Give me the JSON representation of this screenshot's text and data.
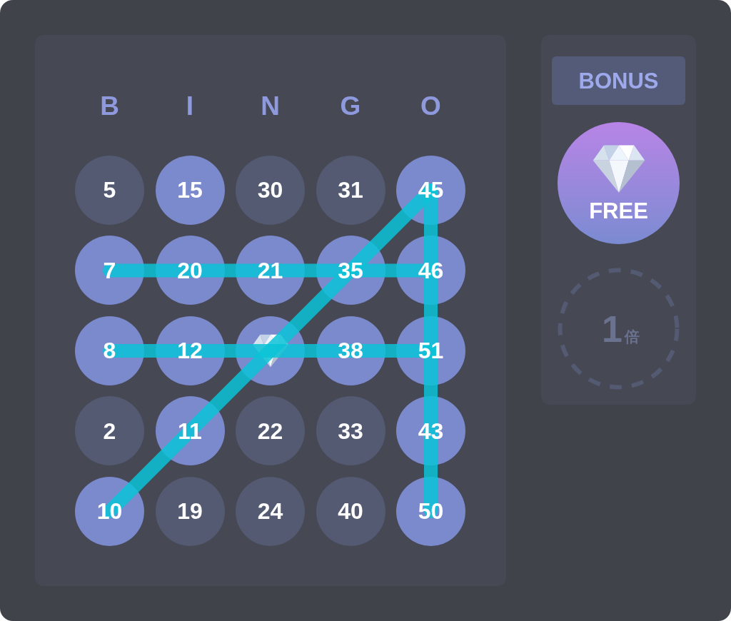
{
  "board": {
    "columns": [
      {
        "letter": "B",
        "line_through": false
      },
      {
        "letter": "I",
        "line_through": false
      },
      {
        "letter": "N",
        "line_through": false
      },
      {
        "letter": "G",
        "line_through": false
      },
      {
        "letter": "O",
        "line_through": true
      }
    ],
    "rows": [
      {
        "line_through": false,
        "cells": [
          {
            "kind": "number",
            "number": "5",
            "marked": false
          },
          {
            "kind": "number",
            "number": "15",
            "marked": true
          },
          {
            "kind": "number",
            "number": "30",
            "marked": false
          },
          {
            "kind": "number",
            "number": "31",
            "marked": false
          },
          {
            "kind": "number",
            "number": "45",
            "marked": true
          }
        ]
      },
      {
        "line_through": true,
        "cells": [
          {
            "kind": "number",
            "number": "7",
            "marked": true
          },
          {
            "kind": "number",
            "number": "20",
            "marked": true
          },
          {
            "kind": "number",
            "number": "21",
            "marked": true
          },
          {
            "kind": "number",
            "number": "35",
            "marked": true
          },
          {
            "kind": "number",
            "number": "46",
            "marked": true
          }
        ]
      },
      {
        "line_through": true,
        "cells": [
          {
            "kind": "number",
            "number": "8",
            "marked": true
          },
          {
            "kind": "number",
            "number": "12",
            "marked": true
          },
          {
            "kind": "free",
            "marked": true
          },
          {
            "kind": "number",
            "number": "38",
            "marked": true
          },
          {
            "kind": "number",
            "number": "51",
            "marked": true
          }
        ]
      },
      {
        "line_through": false,
        "cells": [
          {
            "kind": "number",
            "number": "2",
            "marked": false
          },
          {
            "kind": "number",
            "number": "11",
            "marked": true
          },
          {
            "kind": "number",
            "number": "22",
            "marked": false
          },
          {
            "kind": "number",
            "number": "33",
            "marked": false
          },
          {
            "kind": "number",
            "number": "43",
            "marked": true
          }
        ]
      },
      {
        "line_through": false,
        "cells": [
          {
            "kind": "number",
            "number": "10",
            "marked": true
          },
          {
            "kind": "number",
            "number": "19",
            "marked": false
          },
          {
            "kind": "number",
            "number": "24",
            "marked": false
          },
          {
            "kind": "number",
            "number": "40",
            "marked": false
          },
          {
            "kind": "number",
            "number": "50",
            "marked": true
          }
        ]
      }
    ],
    "diagonals": {
      "rising": true,
      "falling": false
    }
  },
  "bonus_panel": {
    "title": "BONUS",
    "bonuses": [
      {
        "kind": "free",
        "label": "FREE",
        "active": true
      },
      {
        "kind": "multiplier",
        "value": "1",
        "unit": "倍",
        "active": false
      }
    ]
  }
}
